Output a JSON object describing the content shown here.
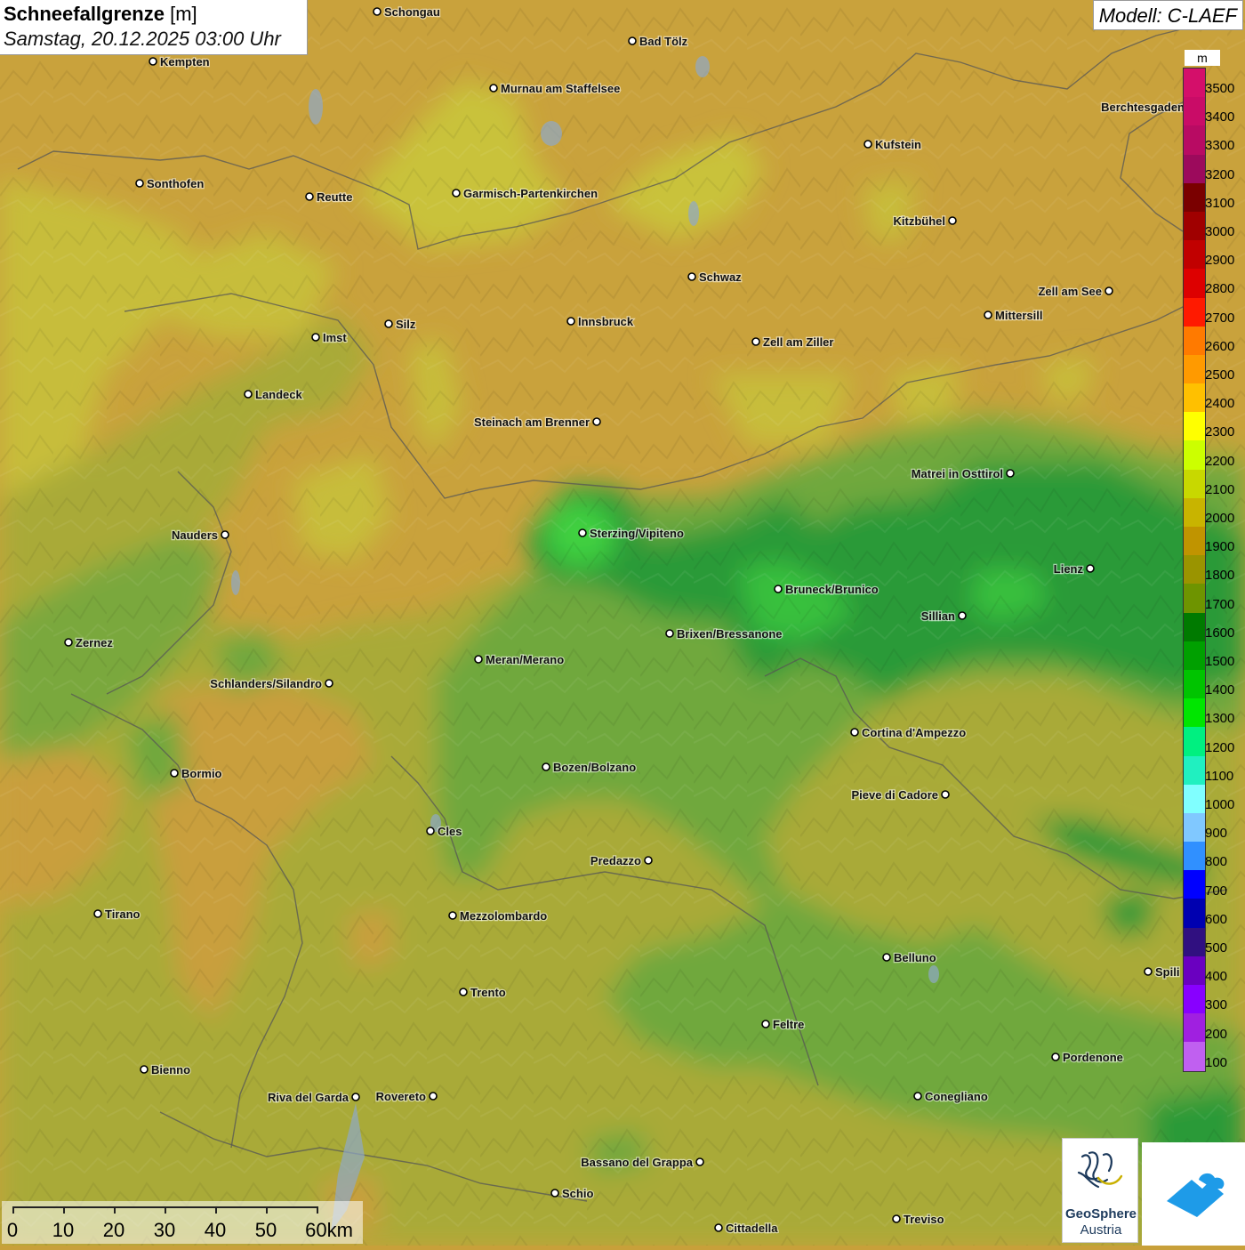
{
  "header": {
    "title": "Schneefallgrenze",
    "unit_suffix": "[m]",
    "datetime": "Samstag, 20.12.2025 03:00 Uhr",
    "model": "Modell: C-LAEF"
  },
  "legend": {
    "unit": "m",
    "levels": [
      {
        "label": "3500",
        "color": "#d40f6a"
      },
      {
        "label": "3400",
        "color": "#c90c67"
      },
      {
        "label": "3300",
        "color": "#b80b63"
      },
      {
        "label": "3200",
        "color": "#9c0a5c"
      },
      {
        "label": "3100",
        "color": "#7a0000"
      },
      {
        "label": "3000",
        "color": "#a00000"
      },
      {
        "label": "2900",
        "color": "#c10000"
      },
      {
        "label": "2800",
        "color": "#dd0000"
      },
      {
        "label": "2700",
        "color": "#ff1a00"
      },
      {
        "label": "2600",
        "color": "#ff7a00"
      },
      {
        "label": "2500",
        "color": "#ff9a00"
      },
      {
        "label": "2400",
        "color": "#ffc000"
      },
      {
        "label": "2300",
        "color": "#ffff00"
      },
      {
        "label": "2200",
        "color": "#ccff00"
      },
      {
        "label": "2100",
        "color": "#c8d800"
      },
      {
        "label": "2000",
        "color": "#c8b400"
      },
      {
        "label": "1900",
        "color": "#c09400"
      },
      {
        "label": "1800",
        "color": "#9a9400"
      },
      {
        "label": "1700",
        "color": "#6e9400"
      },
      {
        "label": "1600",
        "color": "#007a00"
      },
      {
        "label": "1500",
        "color": "#00a000"
      },
      {
        "label": "1400",
        "color": "#00c400"
      },
      {
        "label": "1300",
        "color": "#00e600"
      },
      {
        "label": "1200",
        "color": "#00f080"
      },
      {
        "label": "1100",
        "color": "#20f0c0"
      },
      {
        "label": "1000",
        "color": "#80ffff"
      },
      {
        "label": "900",
        "color": "#80c8ff"
      },
      {
        "label": "800",
        "color": "#3090ff"
      },
      {
        "label": "700",
        "color": "#0000ff"
      },
      {
        "label": "600",
        "color": "#0000b0"
      },
      {
        "label": "500",
        "color": "#301080"
      },
      {
        "label": "400",
        "color": "#6a00c0"
      },
      {
        "label": "300",
        "color": "#8800ff"
      },
      {
        "label": "200",
        "color": "#a020e0"
      },
      {
        "label": "100",
        "color": "#c060f0"
      }
    ]
  },
  "cities": [
    {
      "name": "Schongau"
    },
    {
      "name": "Bad Tölz"
    },
    {
      "name": "Kempten"
    },
    {
      "name": "Murnau am Staffelsee"
    },
    {
      "name": "Berchtesgaden"
    },
    {
      "name": "Kufstein"
    },
    {
      "name": "Sonthofen"
    },
    {
      "name": "Reutte"
    },
    {
      "name": "Garmisch-Partenkirchen"
    },
    {
      "name": "Kitzbühel"
    },
    {
      "name": "Schwaz"
    },
    {
      "name": "Zell am See"
    },
    {
      "name": "Innsbruck"
    },
    {
      "name": "Mittersill"
    },
    {
      "name": "Silz"
    },
    {
      "name": "Imst"
    },
    {
      "name": "Zell am Ziller"
    },
    {
      "name": "Landeck"
    },
    {
      "name": "Steinach am Brenner"
    },
    {
      "name": "Matrei in Osttirol"
    },
    {
      "name": "Nauders"
    },
    {
      "name": "Sterzing/Vipiteno"
    },
    {
      "name": "Lienz"
    },
    {
      "name": "Bruneck/Brunico"
    },
    {
      "name": "Sillian"
    },
    {
      "name": "Zernez"
    },
    {
      "name": "Brixen/Bressanone"
    },
    {
      "name": "Meran/Merano"
    },
    {
      "name": "Schlanders/Silandro"
    },
    {
      "name": "Cortina d'Ampezzo"
    },
    {
      "name": "Bozen/Bolzano"
    },
    {
      "name": "Bormio"
    },
    {
      "name": "Pieve di Cadore"
    },
    {
      "name": "Cles"
    },
    {
      "name": "Predazzo"
    },
    {
      "name": "Tirano"
    },
    {
      "name": "Mezzolombardo"
    },
    {
      "name": "Belluno"
    },
    {
      "name": "Spili"
    },
    {
      "name": "Trento"
    },
    {
      "name": "Feltre"
    },
    {
      "name": "Pordenone"
    },
    {
      "name": "Bienno"
    },
    {
      "name": "Riva del Garda"
    },
    {
      "name": "Rovereto"
    },
    {
      "name": "Conegliano"
    },
    {
      "name": "Bassano del Grappa"
    },
    {
      "name": "Schio"
    },
    {
      "name": "Treviso"
    },
    {
      "name": "Cittadella"
    }
  ],
  "scale_bar": {
    "labels": [
      "0",
      "10",
      "20",
      "30",
      "40",
      "50",
      "60km"
    ]
  },
  "logos": {
    "geosphere_line1": "GeoSphere",
    "geosphere_line2": "Austria"
  },
  "colors": {
    "orange_band": "#c9a23c",
    "yellow_band": "#c9c03a",
    "olive_band": "#a9ab38",
    "green_band": "#6fa83e",
    "dark_green_band": "#2e9a3a",
    "bright_green": "#35c83c"
  }
}
